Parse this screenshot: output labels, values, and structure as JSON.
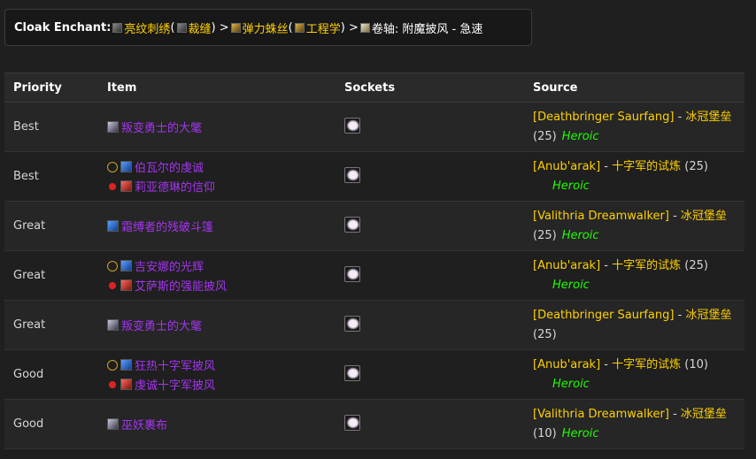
{
  "enchant": {
    "label": "Cloak Enchant:",
    "mat1": "亮纹刺绣",
    "mat1_prof": "裁缝",
    "sep": ">",
    "mat2": "弹力蛛丝",
    "mat2_prof": "工程学",
    "scroll_prefix": "卷轴:",
    "scroll_name": "附魔披风 - 急速",
    "open_paren": "(",
    "close_paren": ")"
  },
  "table": {
    "headers": {
      "priority": "Priority",
      "item": "Item",
      "sockets": "Sockets",
      "source": "Source"
    },
    "rows": [
      {
        "priority": "Best",
        "items": [
          {
            "name": "叛变勇士的大氅",
            "icon": "gray",
            "faction": ""
          }
        ],
        "source": {
          "npc": "[Deathbringer Saurfang]",
          "sep": " - ",
          "zone": "冰冠堡垒",
          "count": "(25)",
          "mode": "Heroic",
          "layout": "wrap"
        }
      },
      {
        "priority": "Best",
        "items": [
          {
            "name": "伯瓦尔的虔诚",
            "icon": "blue",
            "faction": "alliance"
          },
          {
            "name": "莉亚德琳的信仰",
            "icon": "red",
            "faction": "horde"
          }
        ],
        "source": {
          "npc": "[Anub'arak]",
          "sep": " - ",
          "zone": "十字军的试炼",
          "count": "(25)",
          "mode": "Heroic",
          "layout": "count-first"
        }
      },
      {
        "priority": "Great",
        "items": [
          {
            "name": "霜缚者的残破斗篷",
            "icon": "blue",
            "faction": ""
          }
        ],
        "source": {
          "npc": "[Valithria Dreamwalker]",
          "sep": " - ",
          "zone": "冰冠堡垒",
          "count": "(25)",
          "mode": "Heroic",
          "layout": "wrap"
        }
      },
      {
        "priority": "Great",
        "items": [
          {
            "name": "吉安娜的光辉",
            "icon": "blue",
            "faction": "alliance"
          },
          {
            "name": "艾萨斯的强能披风",
            "icon": "red",
            "faction": "horde"
          }
        ],
        "source": {
          "npc": "[Anub'arak]",
          "sep": " - ",
          "zone": "十字军的试炼",
          "count": "(25)",
          "mode": "Heroic",
          "layout": "count-first"
        }
      },
      {
        "priority": "Great",
        "items": [
          {
            "name": "叛变勇士的大氅",
            "icon": "gray",
            "faction": ""
          }
        ],
        "source": {
          "npc": "[Deathbringer Saurfang]",
          "sep": " - ",
          "zone": "冰冠堡垒",
          "count": "(25)",
          "mode": "",
          "layout": "wrap"
        }
      },
      {
        "priority": "Good",
        "items": [
          {
            "name": "狂热十字军披风",
            "icon": "blue",
            "faction": "alliance"
          },
          {
            "name": "虔诚十字军披风",
            "icon": "red",
            "faction": "horde"
          }
        ],
        "source": {
          "npc": "[Anub'arak]",
          "sep": " - ",
          "zone": "十字军的试炼",
          "count": "(10)",
          "mode": "Heroic",
          "layout": "count-first"
        }
      },
      {
        "priority": "Good",
        "items": [
          {
            "name": "巫妖裹布",
            "icon": "gray",
            "faction": ""
          }
        ],
        "source": {
          "npc": "[Valithria Dreamwalker]",
          "sep": " - ",
          "zone": "冰冠堡垒",
          "count": "(10)",
          "mode": "Heroic",
          "layout": "wrap"
        }
      }
    ]
  },
  "colors": {
    "epic": "#a335ee",
    "gold": "#ffd100",
    "heroic": "#1eff00"
  }
}
